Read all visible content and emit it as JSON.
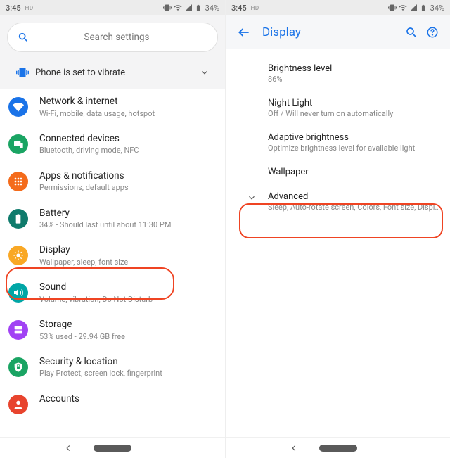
{
  "status": {
    "time": "3:45",
    "hd": "HD",
    "battery": "34%"
  },
  "left": {
    "search_placeholder": "Search settings",
    "vibrate_label": "Phone is set to vibrate",
    "items": [
      {
        "title": "Network & internet",
        "sub": "Wi-Fi, mobile, data usage, hotspot",
        "color": "#1a73e8",
        "icon": "wifi"
      },
      {
        "title": "Connected devices",
        "sub": "Bluetooth, driving mode, NFC",
        "color": "#1aa463",
        "icon": "devices"
      },
      {
        "title": "Apps & notifications",
        "sub": "Permissions, default apps",
        "color": "#f46b1b",
        "icon": "apps"
      },
      {
        "title": "Battery",
        "sub": "34% - Should last until about 11:30 PM",
        "color": "#0f7b6c",
        "icon": "battery"
      },
      {
        "title": "Display",
        "sub": "Wallpaper, sleep, font size",
        "color": "#f9a825",
        "icon": "display"
      },
      {
        "title": "Sound",
        "sub": "Volume, vibration, Do Not Disturb",
        "color": "#00a6a6",
        "icon": "sound"
      },
      {
        "title": "Storage",
        "sub": "53% used - 29.94 GB free",
        "color": "#a142f4",
        "icon": "storage"
      },
      {
        "title": "Security & location",
        "sub": "Play Protect, screen lock, fingerprint",
        "color": "#1aa463",
        "icon": "security"
      },
      {
        "title": "Accounts",
        "sub": "",
        "color": "#e8442e",
        "icon": "accounts"
      }
    ]
  },
  "right": {
    "title": "Display",
    "items": [
      {
        "title": "Brightness level",
        "sub": "86%"
      },
      {
        "title": "Night Light",
        "sub": "Off / Will never turn on automatically"
      },
      {
        "title": "Adaptive brightness",
        "sub": "Optimize brightness level for available light"
      },
      {
        "title": "Wallpaper",
        "sub": ""
      }
    ],
    "advanced": {
      "title": "Advanced",
      "sub": "Sleep, Auto-rotate screen, Colors, Font size, Displa.."
    }
  }
}
